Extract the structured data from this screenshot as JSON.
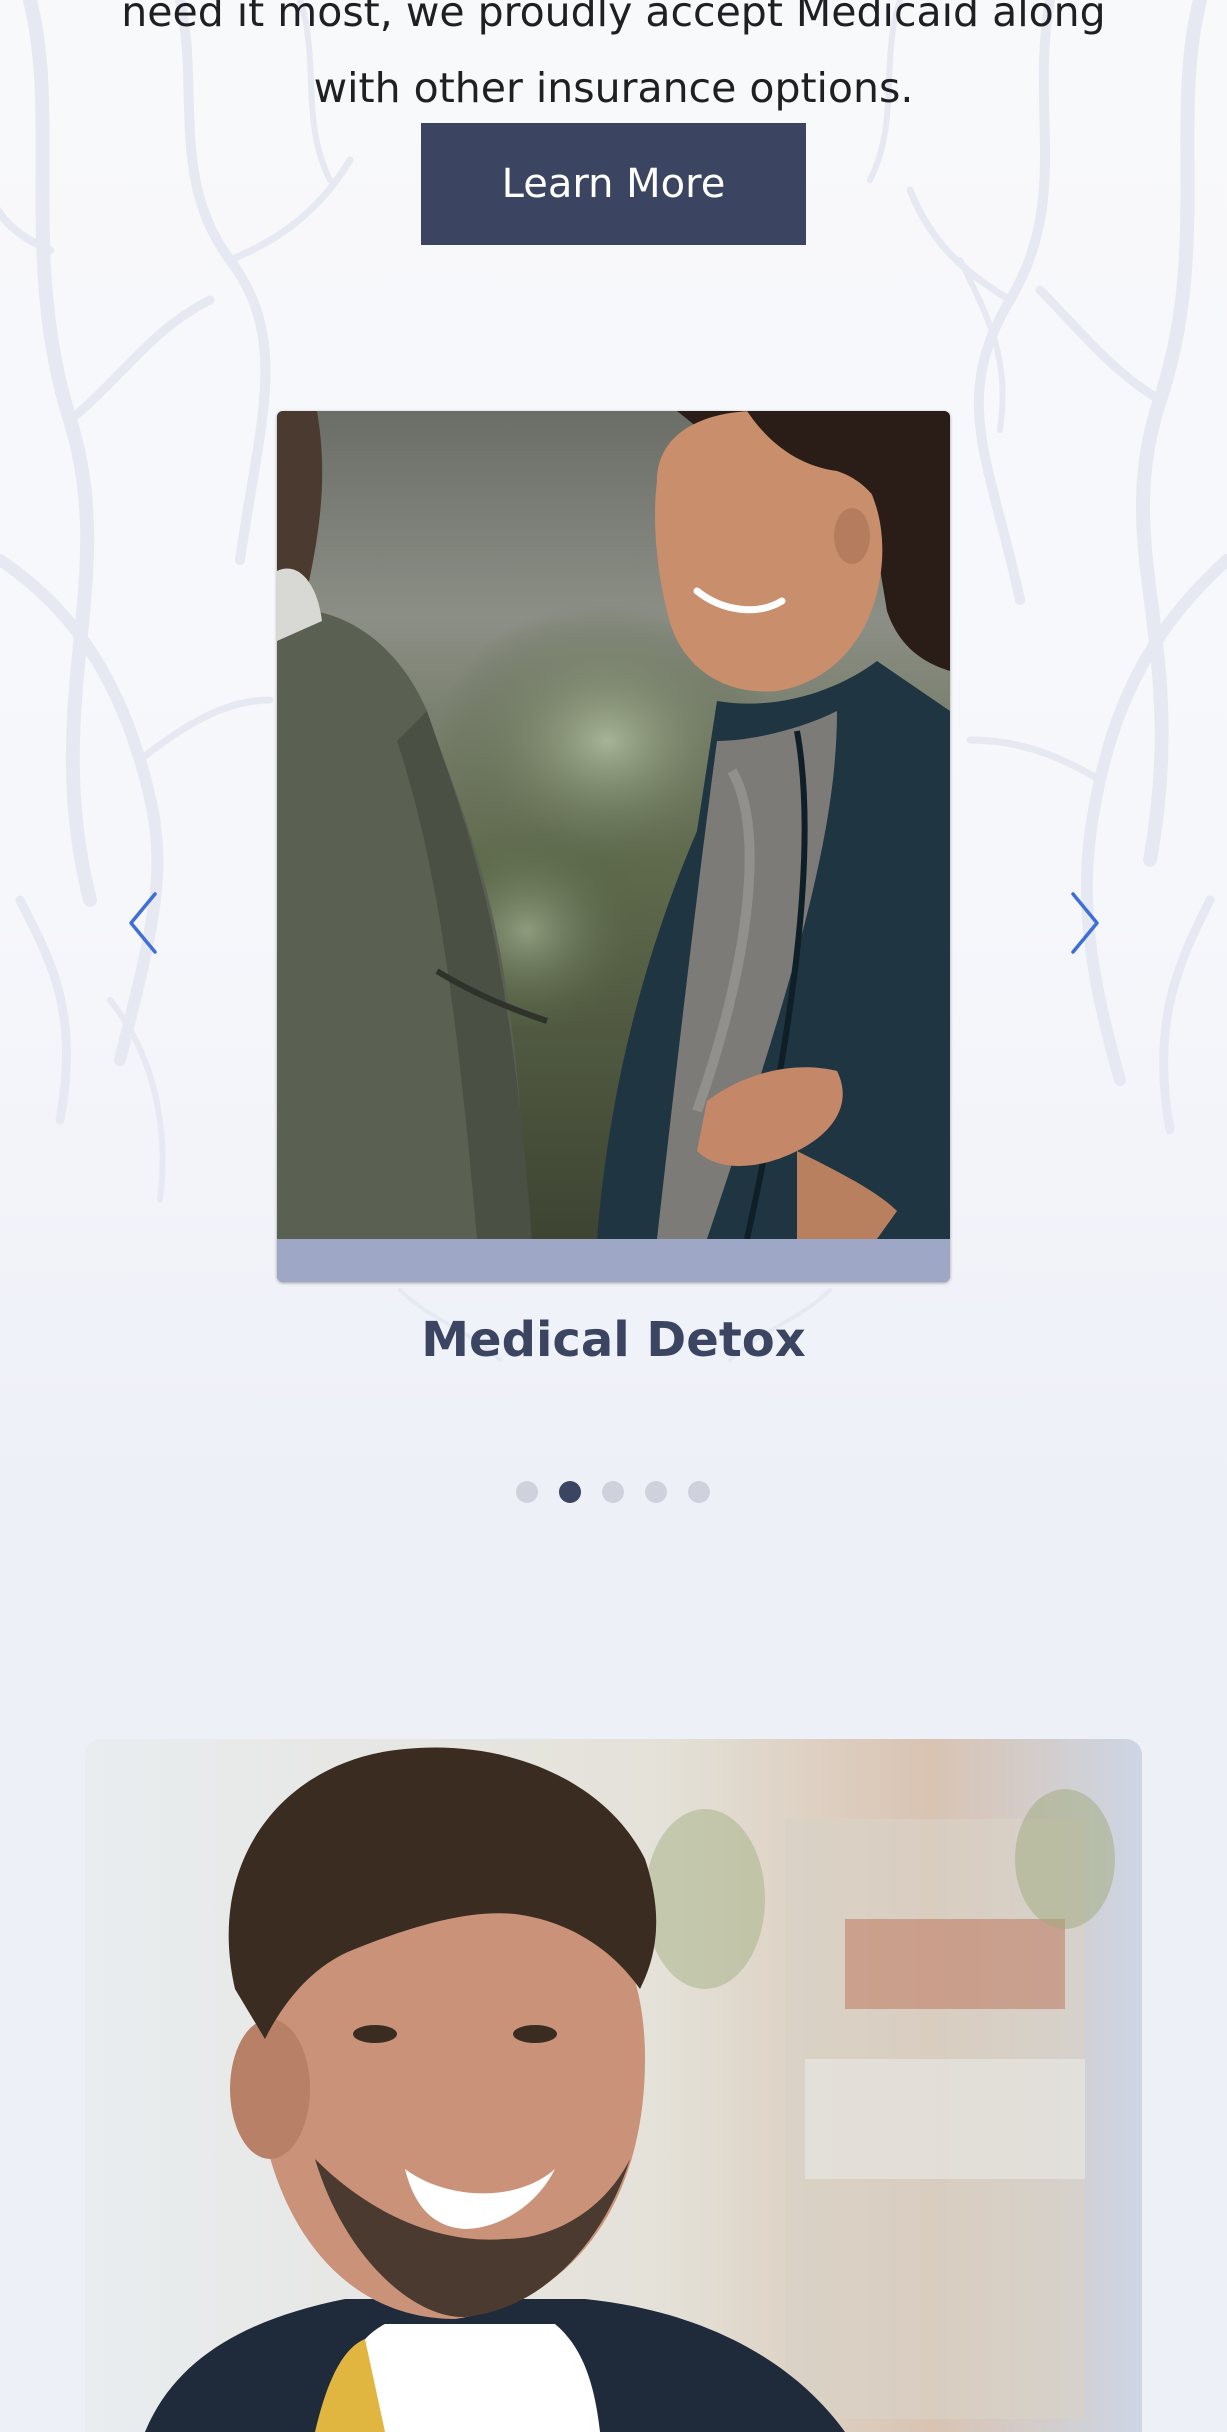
{
  "intro": {
    "line1": "need it most, we proudly accept Medicaid along",
    "line2": "with other insurance options."
  },
  "cta": {
    "label": "Learn More"
  },
  "carousel": {
    "slide_title": "Medical Detox",
    "slide_count": 5,
    "active_index": 1
  },
  "colors": {
    "primary": "#3b4561",
    "arrow": "#3e6fd8",
    "card_bar": "#9ea8c6",
    "background": "#eef0f8"
  },
  "icons": [
    "chevron-left-icon",
    "chevron-right-icon"
  ]
}
